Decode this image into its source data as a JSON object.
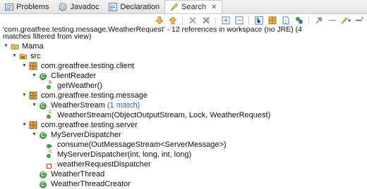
{
  "tabs": [
    {
      "label": "Problems",
      "icon": "problems-icon"
    },
    {
      "label": "Javadoc",
      "icon": "javadoc-icon"
    },
    {
      "label": "Declaration",
      "icon": "declaration-icon"
    },
    {
      "label": "Search",
      "icon": "search-icon",
      "active": true,
      "close": "✕"
    }
  ],
  "status": {
    "line1": "'com.greatfree.testing.message.WeatherRequest' - 12 references in workspace (no JRE) (4",
    "line2": "matches filtered from view)"
  },
  "tree": {
    "project": "Mama",
    "src": "src",
    "pkg_client": "com.greatfree.testing.client",
    "client_reader": "ClientReader",
    "get_weather": "getWeather()",
    "pkg_message": "com.greatfree.testing.message",
    "weather_stream": "WeatherStream",
    "weather_stream_match": "(1 match)",
    "weather_stream_ctor": "WeatherStream(ObjectOutputStream, Lock, WeatherRequest)",
    "pkg_server": "com.greatfree.testing.server",
    "server_dispatcher": "MyServerDispatcher",
    "consume": "consume(OutMessageStream<ServerMessage>)",
    "server_dispatcher_ctor": "MyServerDispatcher(int, long, int, long)",
    "weather_request_dispatcher": "weatherRequestDispatcher",
    "weather_thread": "WeatherThread",
    "weather_thread_creator": "WeatherThreadCreator"
  },
  "colors": {
    "accent": "#2a6bb5",
    "class_icon": "#3f9a3f"
  }
}
